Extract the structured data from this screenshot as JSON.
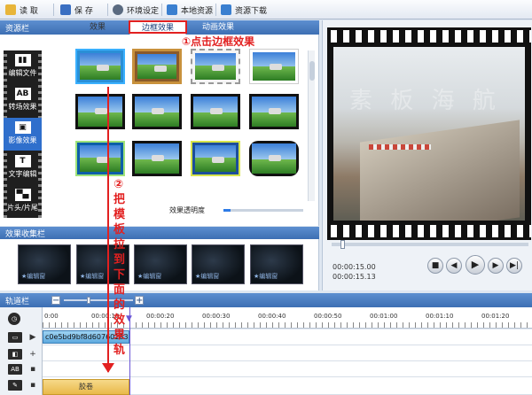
{
  "toolbar": {
    "items": [
      {
        "icon": "open-folder-icon",
        "label": "读 取"
      },
      {
        "icon": "save-icon",
        "label": "保 存"
      },
      {
        "icon": "gear-icon",
        "label": "环境设定"
      },
      {
        "icon": "upload-icon",
        "label": "本地资源"
      },
      {
        "icon": "download-icon",
        "label": "资源下载"
      }
    ]
  },
  "resources": {
    "title": "资源栏",
    "tabs": [
      "效果",
      "边框效果",
      "动画效果"
    ],
    "active_tab": 1,
    "side_menu": [
      "编辑文件",
      "转场效果",
      "影像效果",
      "文字编辑",
      "片头/片尾"
    ],
    "side_glyphs": [
      "▮▮",
      "AB",
      "▣",
      "T",
      "▀▄"
    ],
    "active_side": 2,
    "opacity_label": "效果透明度"
  },
  "collection": {
    "title": "效果收集栏",
    "thumb_label": "★编辑窗"
  },
  "preview": {
    "watermark": "素 板 海 航",
    "total_time": "00:00:15.00",
    "current_time": "00:00:15.13",
    "buttons": {
      "stop": "■",
      "prev": "◀",
      "play": "▶",
      "next": "▶",
      "end": "▶|"
    }
  },
  "timeline": {
    "title": "轨道栏",
    "zoom_minus": "−",
    "zoom_plus": "+",
    "ticks": [
      "0:00",
      "00:00:10",
      "00:00:20",
      "00:00:30",
      "00:00:40",
      "00:00:50",
      "00:01:00",
      "00:01:10",
      "00:01:20"
    ],
    "clip_name": "c0e5bd9bf8d60760183",
    "film_label": "胶卷",
    "track_icons": [
      "▭",
      "◧",
      "AB",
      "✎"
    ]
  },
  "annotations": {
    "step1": "①点击边框效果",
    "step2": "②把模板拉到下面的效果轨"
  },
  "colors": {
    "accent_blue": "#3d6fb3",
    "annotation_red": "#e22020",
    "playhead": "#6a55d6",
    "clip_blue": "#5ea9de",
    "film_clip": "#e9b94a"
  }
}
